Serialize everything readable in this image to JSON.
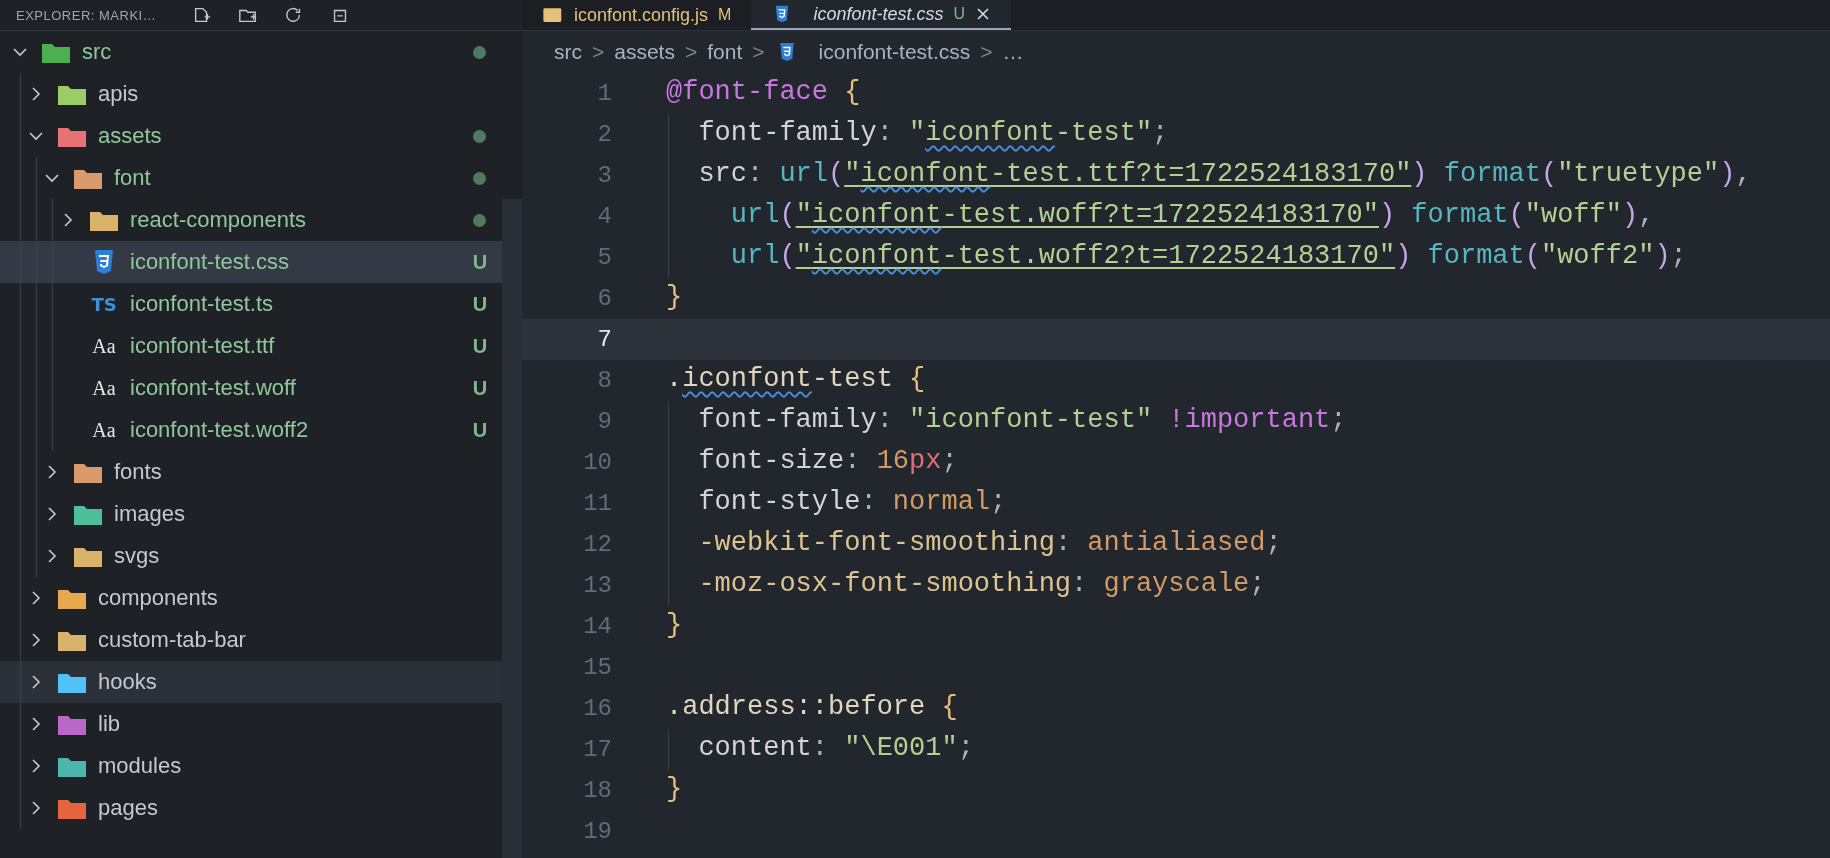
{
  "explorer": {
    "title": "EXPLORER: MARKI…"
  },
  "tabs": [
    {
      "label": "iconfont.config.js",
      "kind": "js",
      "badge": "M",
      "selected": false,
      "preview": false
    },
    {
      "label": "iconfont-test.css",
      "kind": "css",
      "badge": "U",
      "selected": true,
      "preview": true
    }
  ],
  "tree": [
    {
      "name": "src",
      "kind": "folder",
      "color": "#4caf50",
      "expanded": true,
      "modified": true,
      "selected": false,
      "hovered": false,
      "children": [
        {
          "name": "apis",
          "kind": "folder",
          "color": "#9ccc65",
          "expanded": false,
          "modified": false,
          "selected": false,
          "hovered": false
        },
        {
          "name": "assets",
          "kind": "folder",
          "color": "#e57373",
          "expanded": true,
          "modified": true,
          "selected": false,
          "hovered": false,
          "children": [
            {
              "name": "font",
              "kind": "folder",
              "color": "#d99a6c",
              "expanded": true,
              "modified": true,
              "selected": false,
              "hovered": false,
              "children": [
                {
                  "name": "react-components",
                  "kind": "folder",
                  "color": "#d9b36a",
                  "expanded": false,
                  "modified": true,
                  "selected": false,
                  "hovered": false
                },
                {
                  "name": "iconfont-test.css",
                  "kind": "css",
                  "modified": true,
                  "badge": "U",
                  "selected": true,
                  "hovered": false
                },
                {
                  "name": "iconfont-test.ts",
                  "kind": "ts",
                  "icon_text": "TS",
                  "modified": true,
                  "badge": "U",
                  "selected": false,
                  "hovered": false
                },
                {
                  "name": "iconfont-test.ttf",
                  "kind": "font",
                  "icon_text": "Aa",
                  "modified": true,
                  "badge": "U",
                  "selected": false,
                  "hovered": false
                },
                {
                  "name": "iconfont-test.woff",
                  "kind": "font",
                  "icon_text": "Aa",
                  "modified": true,
                  "badge": "U",
                  "selected": false,
                  "hovered": false
                },
                {
                  "name": "iconfont-test.woff2",
                  "kind": "font",
                  "icon_text": "Aa",
                  "modified": true,
                  "badge": "U",
                  "selected": false,
                  "hovered": false
                }
              ]
            },
            {
              "name": "fonts",
              "kind": "folder",
              "color": "#d99a6c",
              "expanded": false,
              "modified": false,
              "selected": false,
              "hovered": false
            },
            {
              "name": "images",
              "kind": "folder",
              "color": "#4dbf9a",
              "expanded": false,
              "modified": false,
              "selected": false,
              "hovered": false
            },
            {
              "name": "svgs",
              "kind": "folder",
              "color": "#d9b36a",
              "expanded": false,
              "modified": false,
              "selected": false,
              "hovered": false
            }
          ]
        },
        {
          "name": "components",
          "kind": "folder",
          "color": "#e8a94e",
          "expanded": false,
          "modified": false,
          "selected": false,
          "hovered": false
        },
        {
          "name": "custom-tab-bar",
          "kind": "folder",
          "color": "#d9b36a",
          "expanded": false,
          "modified": false,
          "selected": false,
          "hovered": false
        },
        {
          "name": "hooks",
          "kind": "folder",
          "color": "#4fc3f7",
          "expanded": false,
          "modified": false,
          "selected": false,
          "hovered": true
        },
        {
          "name": "lib",
          "kind": "folder",
          "color": "#ba68c8",
          "expanded": false,
          "modified": false,
          "selected": false,
          "hovered": false
        },
        {
          "name": "modules",
          "kind": "folder",
          "color": "#4db6ac",
          "expanded": false,
          "modified": false,
          "selected": false,
          "hovered": false
        },
        {
          "name": "pages",
          "kind": "folder",
          "color": "#e5643e",
          "expanded": false,
          "modified": false,
          "selected": false,
          "hovered": false
        }
      ]
    }
  ],
  "breadcrumb": [
    {
      "label": "src",
      "kind": "folder"
    },
    {
      "label": "assets",
      "kind": "folder"
    },
    {
      "label": "font",
      "kind": "folder"
    },
    {
      "label": "iconfont-test.css",
      "kind": "css"
    },
    {
      "label": "…",
      "kind": "more"
    }
  ],
  "separator": ">",
  "code": [
    {
      "number": "1",
      "current": false,
      "text": "@font-face {"
    },
    {
      "number": "2",
      "current": false,
      "misspelled": true,
      "text": "  font-family: \"iconfont-test\";"
    },
    {
      "number": "3",
      "current": false,
      "misspelled": true,
      "text": "  src: url(\"iconfont-test.ttf?t=1722524183170\") format(\"truetype\"),"
    },
    {
      "number": "4",
      "current": false,
      "misspelled": true,
      "text": "    url(\"iconfont-test.woff?t=1722524183170\") format(\"woff\"),"
    },
    {
      "number": "5",
      "current": false,
      "misspelled": true,
      "text": "    url(\"iconfont-test.woff2?t=1722524183170\") format(\"woff2\");"
    },
    {
      "number": "6",
      "current": false,
      "text": "}"
    },
    {
      "number": "7",
      "current": true
    },
    {
      "number": "8",
      "current": false,
      "misspelled": true,
      "text": ".iconfont-test {"
    },
    {
      "number": "9",
      "current": false,
      "text": "  font-family: \"iconfont-test\" !important;"
    },
    {
      "number": "10",
      "current": false,
      "text": "  font-size: 16px;"
    },
    {
      "number": "11",
      "current": false,
      "text": "  font-style: normal;"
    },
    {
      "number": "12",
      "current": false,
      "text": "  -webkit-font-smoothing: antialiased;"
    },
    {
      "number": "13",
      "current": false,
      "text": "  -moz-osx-font-smoothing: grayscale;"
    },
    {
      "number": "14",
      "current": false,
      "text": "}"
    },
    {
      "number": "15",
      "current": false
    },
    {
      "number": "16",
      "current": false,
      "text": ".address::before {"
    },
    {
      "number": "17",
      "current": false,
      "text": "  content: \"\\E001\";"
    },
    {
      "number": "18",
      "current": false,
      "text": "}"
    },
    {
      "number": "19",
      "current": false
    }
  ]
}
